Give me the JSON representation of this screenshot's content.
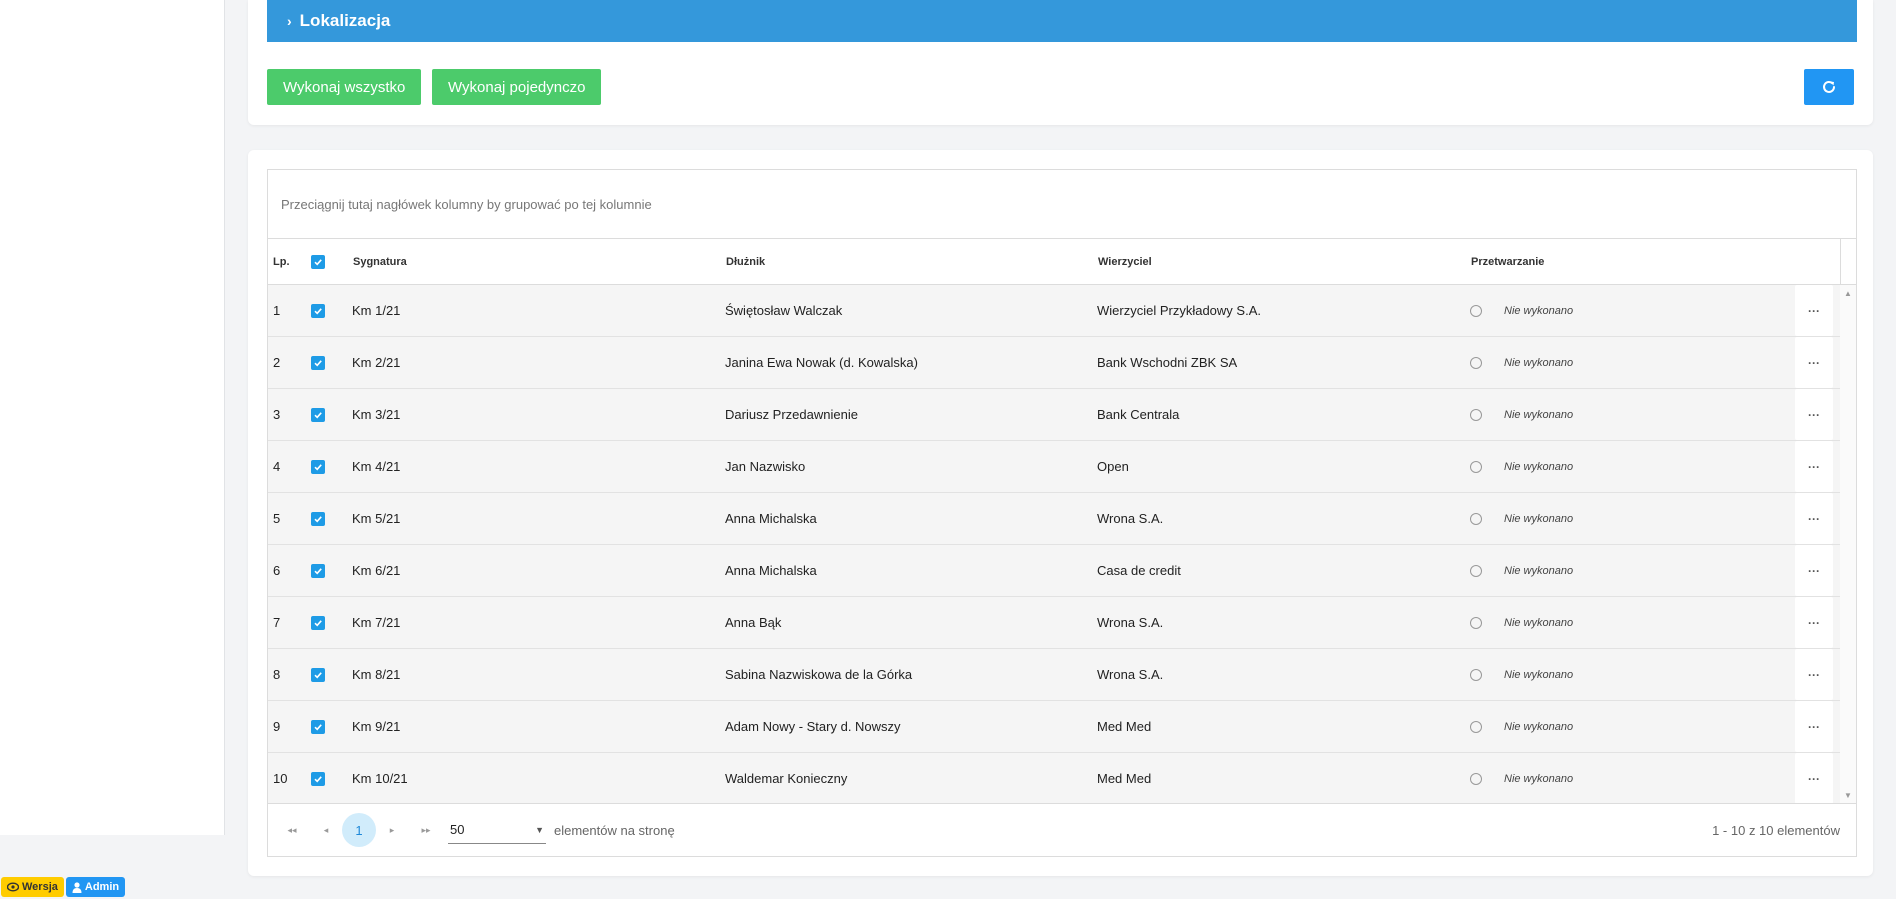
{
  "section": {
    "title": "Lokalizacja"
  },
  "actions": {
    "execute_all": "Wykonaj wszystko",
    "execute_single": "Wykonaj pojedynczo"
  },
  "colors": {
    "primary": "#3498db",
    "success": "#4ccb6b",
    "refresh": "#2196f3",
    "checkbox": "#1e9be6"
  },
  "grid": {
    "group_hint": "Przeciągnij tutaj nagłówek kolumny by grupować po tej kolumnie",
    "columns": {
      "lp": "Lp.",
      "signature": "Sygnatura",
      "debtor": "Dłużnik",
      "creditor": "Wierzyciel",
      "processing": "Przetwarzanie"
    },
    "rows": [
      {
        "lp": "1",
        "signature": "Km 1/21",
        "debtor": "Świętosław Walczak",
        "creditor": "Wierzyciel Przykładowy S.A.",
        "status": "Nie wykonano",
        "checked": true
      },
      {
        "lp": "2",
        "signature": "Km 2/21",
        "debtor": "Janina Ewa Nowak (d. Kowalska)",
        "creditor": "Bank Wschodni ZBK SA",
        "status": "Nie wykonano",
        "checked": true
      },
      {
        "lp": "3",
        "signature": "Km 3/21",
        "debtor": "Dariusz Przedawnienie",
        "creditor": "Bank Centrala",
        "status": "Nie wykonano",
        "checked": true
      },
      {
        "lp": "4",
        "signature": "Km 4/21",
        "debtor": "Jan Nazwisko",
        "creditor": "Open",
        "status": "Nie wykonano",
        "checked": true
      },
      {
        "lp": "5",
        "signature": "Km 5/21",
        "debtor": "Anna Michalska",
        "creditor": "Wrona S.A.",
        "status": "Nie wykonano",
        "checked": true
      },
      {
        "lp": "6",
        "signature": "Km 6/21",
        "debtor": "Anna Michalska",
        "creditor": "Casa de credit",
        "status": "Nie wykonano",
        "checked": true
      },
      {
        "lp": "7",
        "signature": "Km 7/21",
        "debtor": "Anna Bąk",
        "creditor": "Wrona S.A.",
        "status": "Nie wykonano",
        "checked": true
      },
      {
        "lp": "8",
        "signature": "Km 8/21",
        "debtor": "Sabina Nazwiskowa de la Górka",
        "creditor": "Wrona S.A.",
        "status": "Nie wykonano",
        "checked": true
      },
      {
        "lp": "9",
        "signature": "Km 9/21",
        "debtor": "Adam Nowy - Stary d. Nowszy",
        "creditor": "Med Med",
        "status": "Nie wykonano",
        "checked": true
      },
      {
        "lp": "10",
        "signature": "Km 10/21",
        "debtor": "Waldemar Konieczny",
        "creditor": "Med Med",
        "status": "Nie wykonano",
        "checked": true
      }
    ],
    "more_label": "···"
  },
  "pager": {
    "current_page": "1",
    "page_size": "50",
    "page_size_label": "elementów na stronę",
    "info": "1 - 10 z 10 elementów"
  },
  "footer": {
    "version_label": "Wersja",
    "user_label": "Admin"
  },
  "icons": {
    "refresh": "refresh-icon",
    "version": "eye-icon",
    "user": "user-icon",
    "first": "first-page-icon",
    "prev": "prev-page-icon",
    "next": "next-page-icon",
    "last": "last-page-icon"
  }
}
